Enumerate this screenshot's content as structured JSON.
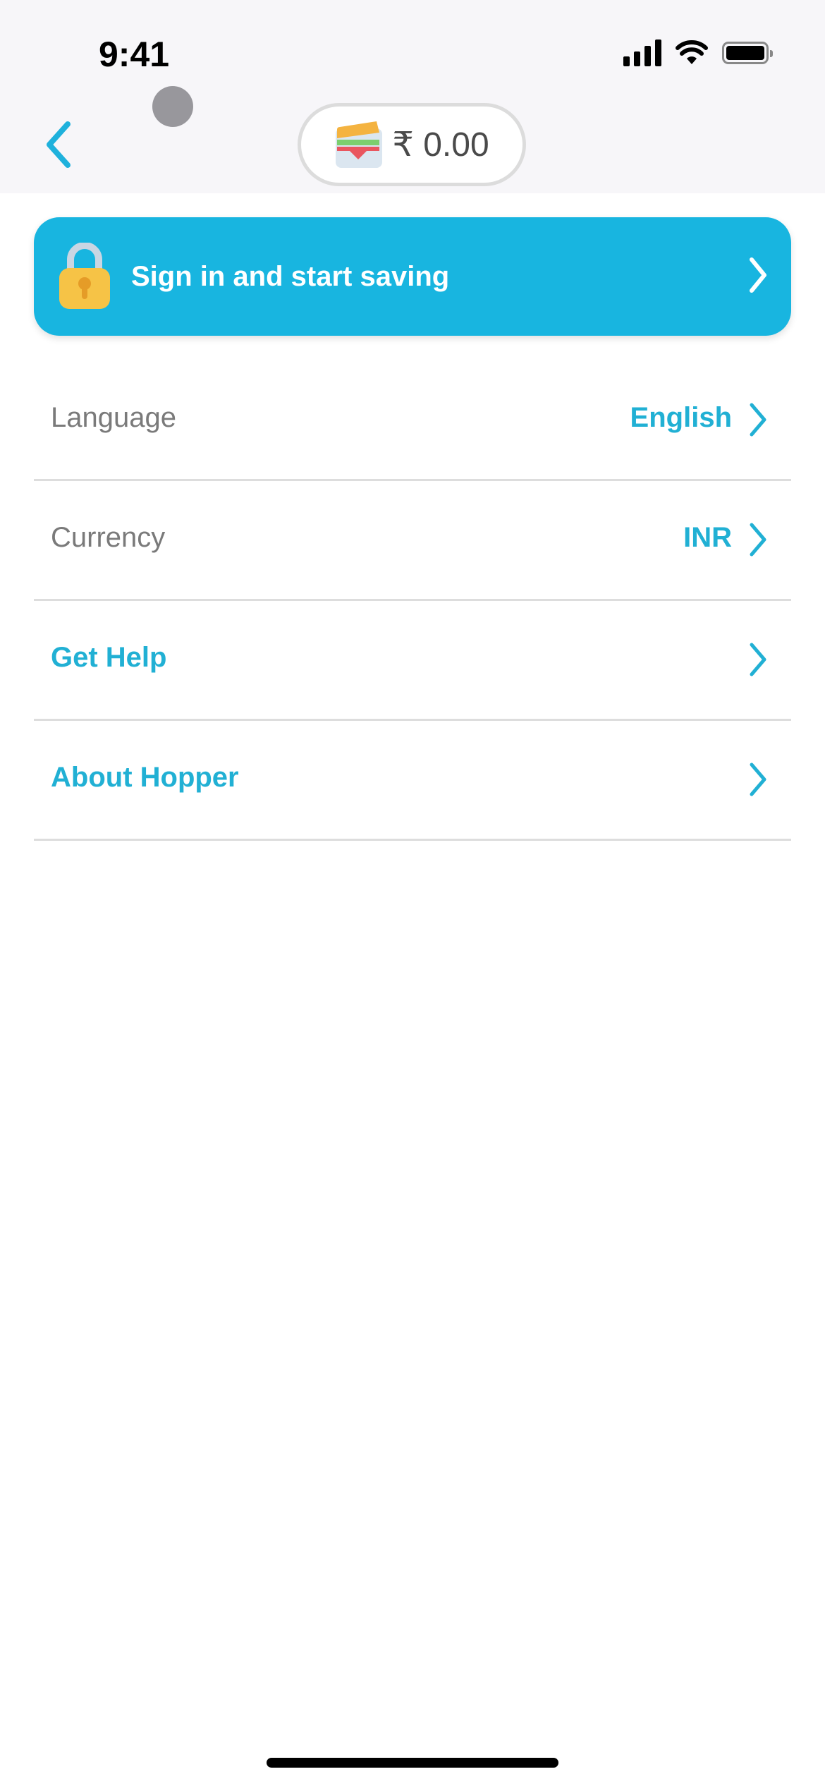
{
  "status_bar": {
    "time": "9:41"
  },
  "header": {
    "back_icon": "chevron-left-icon",
    "wallet": {
      "icon": "wallet-icon",
      "amount": "₹ 0.00"
    }
  },
  "banner": {
    "icon": "lock-icon",
    "label": "Sign in and start saving"
  },
  "settings": [
    {
      "label": "Language",
      "value": "English",
      "style": "gray"
    },
    {
      "label": "Currency",
      "value": "INR",
      "style": "gray"
    },
    {
      "label": "Get Help",
      "value": "",
      "style": "blue"
    },
    {
      "label": "About Hopper",
      "value": "",
      "style": "blue"
    }
  ],
  "colors": {
    "accent": "#18b5e0",
    "link": "#21b0d4",
    "label_gray": "#7a7a7a"
  }
}
